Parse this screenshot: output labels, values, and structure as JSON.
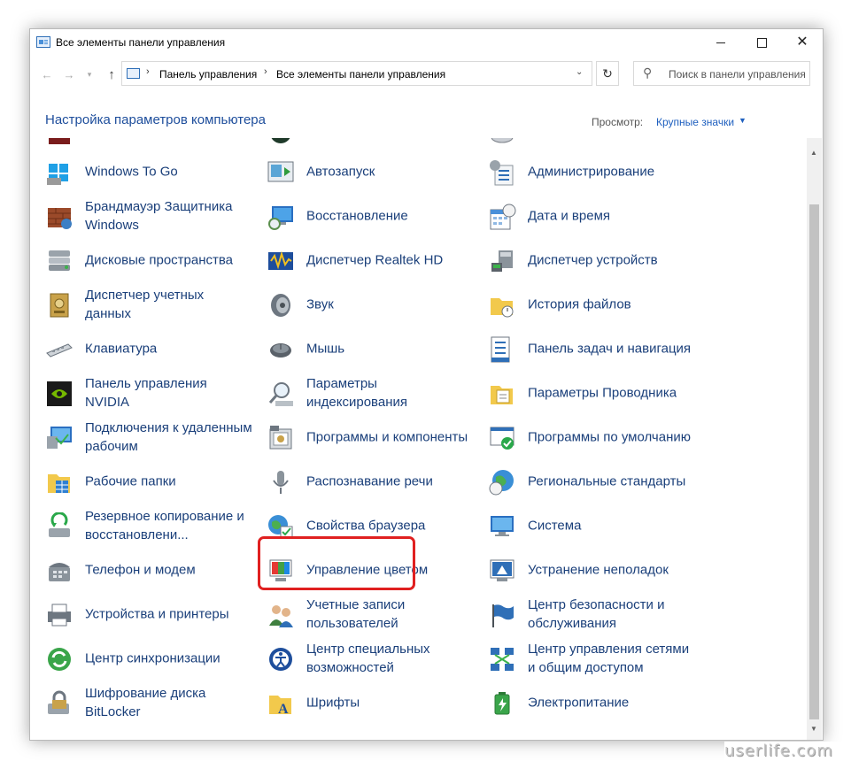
{
  "window": {
    "title": "Все элементы панели управления"
  },
  "address": {
    "crumbs": [
      "Панель управления",
      "Все элементы панели управления"
    ],
    "separator": "›",
    "search_placeholder": "Поиск в панели управления"
  },
  "header": {
    "title": "Настройка параметров компьютера",
    "view_label": "Просмотр:",
    "view_value": "Крупные значки"
  },
  "highlight_color": "#e02020",
  "link_color": "#1a3f7a",
  "items": [
    {
      "label": "Windows To Go",
      "icon": "usb-drive-icon"
    },
    {
      "label": "Автозапуск",
      "icon": "autoplay-icon"
    },
    {
      "label": "Администрирование",
      "icon": "admin-tools-icon"
    },
    {
      "label": "Брандмауэр Защитника Windows",
      "icon": "firewall-icon"
    },
    {
      "label": "Восстановление",
      "icon": "recovery-icon"
    },
    {
      "label": "Дата и время",
      "icon": "calendar-clock-icon"
    },
    {
      "label": "Дисковые пространства",
      "icon": "storage-spaces-icon"
    },
    {
      "label": "Диспетчер Realtek HD",
      "icon": "realtek-audio-icon"
    },
    {
      "label": "Диспетчер устройств",
      "icon": "device-manager-icon"
    },
    {
      "label": "Диспетчер учетных данных",
      "icon": "credential-vault-icon"
    },
    {
      "label": "Звук",
      "icon": "speaker-icon"
    },
    {
      "label": "История файлов",
      "icon": "file-history-icon"
    },
    {
      "label": "Клавиатура",
      "icon": "keyboard-icon"
    },
    {
      "label": "Мышь",
      "icon": "mouse-icon"
    },
    {
      "label": "Панель задач и навигация",
      "icon": "taskbar-icon"
    },
    {
      "label": "Панель управления NVIDIA",
      "icon": "nvidia-icon"
    },
    {
      "label": "Параметры индексирования",
      "icon": "indexing-icon"
    },
    {
      "label": "Параметры Проводника",
      "icon": "folder-options-icon"
    },
    {
      "label": "Подключения к удаленным рабочим",
      "icon": "remote-desktop-icon"
    },
    {
      "label": "Программы и компоненты",
      "icon": "programs-features-icon"
    },
    {
      "label": "Программы по умолчанию",
      "icon": "default-programs-icon"
    },
    {
      "label": "Рабочие папки",
      "icon": "work-folders-icon"
    },
    {
      "label": "Распознавание речи",
      "icon": "microphone-icon"
    },
    {
      "label": "Региональные стандарты",
      "icon": "globe-clock-icon"
    },
    {
      "label": "Резервное копирование и восстановлени...",
      "icon": "backup-icon"
    },
    {
      "label": "Свойства браузера",
      "icon": "internet-options-icon"
    },
    {
      "label": "Система",
      "icon": "computer-icon"
    },
    {
      "label": "Телефон и модем",
      "icon": "phone-icon"
    },
    {
      "label": "Управление цветом",
      "icon": "color-management-icon"
    },
    {
      "label": "Устранение неполадок",
      "icon": "troubleshooting-icon"
    },
    {
      "label": "Устройства и принтеры",
      "icon": "printer-icon"
    },
    {
      "label": "Учетные записи пользователей",
      "icon": "user-accounts-icon"
    },
    {
      "label": "Центр безопасности и обслуживания",
      "icon": "flag-icon"
    },
    {
      "label": "Центр синхронизации",
      "icon": "sync-icon"
    },
    {
      "label": "Центр специальных возможностей",
      "icon": "accessibility-icon"
    },
    {
      "label": "Центр управления сетями и общим доступом",
      "icon": "network-icon"
    },
    {
      "label": "Шифрование диска BitLocker",
      "icon": "bitlocker-icon"
    },
    {
      "label": "Шрифты",
      "icon": "fonts-icon"
    },
    {
      "label": "Электропитание",
      "icon": "battery-icon"
    }
  ],
  "watermark": "userlife.com"
}
